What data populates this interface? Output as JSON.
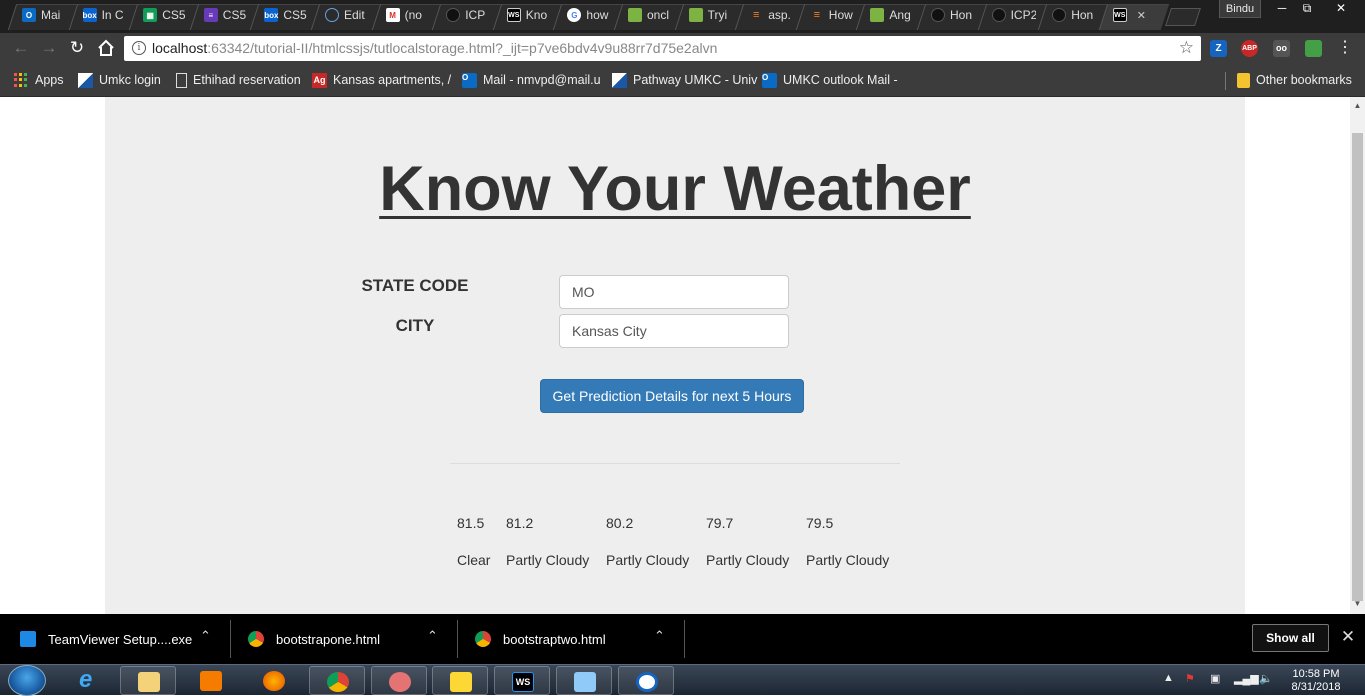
{
  "browser": {
    "tabs": [
      {
        "label": "Mai",
        "favicon": "outlook-icon"
      },
      {
        "label": "In C",
        "favicon": "box-icon"
      },
      {
        "label": "CS5",
        "favicon": "sheets-icon"
      },
      {
        "label": "CS5",
        "favicon": "forms-icon"
      },
      {
        "label": "CS5",
        "favicon": "box-icon"
      },
      {
        "label": "Edit",
        "favicon": "cloud-icon"
      },
      {
        "label": "(no",
        "favicon": "gmail-icon"
      },
      {
        "label": "ICP",
        "favicon": "github-icon"
      },
      {
        "label": "Kno",
        "favicon": "webstorm-icon"
      },
      {
        "label": "how",
        "favicon": "google-icon"
      },
      {
        "label": "oncl",
        "favicon": "chart-icon"
      },
      {
        "label": "Tryi",
        "favicon": "chart-icon"
      },
      {
        "label": "asp.",
        "favicon": "stackoverflow-icon"
      },
      {
        "label": "How",
        "favicon": "stackoverflow-icon"
      },
      {
        "label": "Ang",
        "favicon": "chart-icon"
      },
      {
        "label": "Hon",
        "favicon": "github-icon"
      },
      {
        "label": "ICP2",
        "favicon": "github-icon"
      },
      {
        "label": "Hon",
        "favicon": "github-icon"
      },
      {
        "label": "",
        "favicon": "webstorm-icon",
        "active": true
      }
    ],
    "profile_name": "Bindu",
    "url_host": "localhost",
    "url_rest": ":63342/tutorial-II/htmlcssjs/tutlocalstorage.html?_ijt=p7ve6bdv4v9u88rr7d75e2alvn",
    "extensions": [
      "Z",
      "ABP",
      "oo",
      ""
    ],
    "bookmarks": [
      {
        "label": "Apps",
        "icon": "apps-grid-icon"
      },
      {
        "label": "Umkc login",
        "icon": "umkc-icon"
      },
      {
        "label": "Ethihad reservation",
        "icon": "page-icon"
      },
      {
        "label": "Kansas apartments, /",
        "icon": "ag-icon"
      },
      {
        "label": "Mail - nmvpd@mail.u",
        "icon": "outlook-icon"
      },
      {
        "label": "Pathway UMKC - Univ",
        "icon": "umkc-icon"
      },
      {
        "label": "UMKC outlook Mail -",
        "icon": "outlook-icon"
      }
    ],
    "other_bookmarks": "Other bookmarks"
  },
  "page": {
    "title": "Know Your Weather",
    "state_label": "STATE CODE",
    "state_value": "MO",
    "city_label": "CITY",
    "city_value": "Kansas City",
    "submit_label": "Get Prediction Details for next 5 Hours",
    "forecast": [
      {
        "temp": "81.5",
        "condition": "Clear"
      },
      {
        "temp": "81.2",
        "condition": "Partly Cloudy"
      },
      {
        "temp": "80.2",
        "condition": "Partly Cloudy"
      },
      {
        "temp": "79.7",
        "condition": "Partly Cloudy"
      },
      {
        "temp": "79.5",
        "condition": "Partly Cloudy"
      }
    ]
  },
  "downloads": {
    "items": [
      {
        "label": "TeamViewer Setup....exe",
        "icon": "teamviewer-icon"
      },
      {
        "label": "bootstrapone.html",
        "icon": "chrome-icon"
      },
      {
        "label": "bootstraptwo.html",
        "icon": "chrome-icon"
      }
    ],
    "show_all": "Show all"
  },
  "taskbar": {
    "apps": [
      "internet-explorer-icon",
      "file-explorer-icon",
      "media-player-icon",
      "firefox-icon",
      "chrome-icon",
      "snipping-tool-icon",
      "folder-icon",
      "webstorm-icon",
      "notepad-icon",
      "teamviewer-icon"
    ],
    "time": "10:58 PM",
    "date": "8/31/2018"
  },
  "colors": {
    "page_background": "#eeeeee",
    "primary_button": "#337ab7",
    "browser_frame": "#3c3c3c"
  }
}
